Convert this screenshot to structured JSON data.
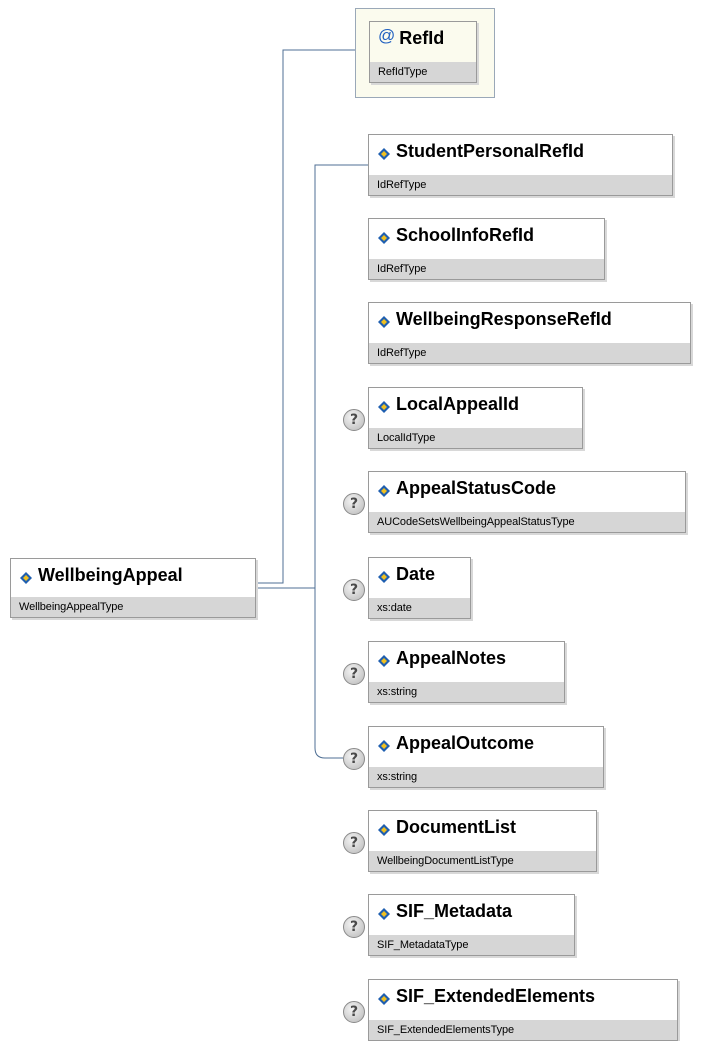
{
  "root": {
    "name": "WellbeingAppeal",
    "type": "WellbeingAppealType"
  },
  "attribute": {
    "name": "RefId",
    "type": "RefIdType",
    "marker": "@"
  },
  "optional_marker": "?",
  "elements": [
    {
      "name": "StudentPersonalRefId",
      "type": "IdRefType",
      "optional": false
    },
    {
      "name": "SchoolInfoRefId",
      "type": "IdRefType",
      "optional": false
    },
    {
      "name": "WellbeingResponseRefId",
      "type": "IdRefType",
      "optional": false
    },
    {
      "name": "LocalAppealId",
      "type": "LocalIdType",
      "optional": true
    },
    {
      "name": "AppealStatusCode",
      "type": "AUCodeSetsWellbeingAppealStatusType",
      "optional": true
    },
    {
      "name": "Date",
      "type": "xs:date",
      "optional": true
    },
    {
      "name": "AppealNotes",
      "type": "xs:string",
      "optional": true
    },
    {
      "name": "AppealOutcome",
      "type": "xs:string",
      "optional": true
    },
    {
      "name": "DocumentList",
      "type": "WellbeingDocumentListType",
      "optional": true
    },
    {
      "name": "SIF_Metadata",
      "type": "SIF_MetadataType",
      "optional": true
    },
    {
      "name": "SIF_ExtendedElements",
      "type": "SIF_ExtendedElementsType",
      "optional": true
    }
  ],
  "colors": {
    "connector": "#4f6f94",
    "type_band": "#d6d6d6",
    "attribute_bg": "#fbfbee",
    "icon_blue": "#1f5fb0",
    "icon_yellow": "#f0c020"
  }
}
